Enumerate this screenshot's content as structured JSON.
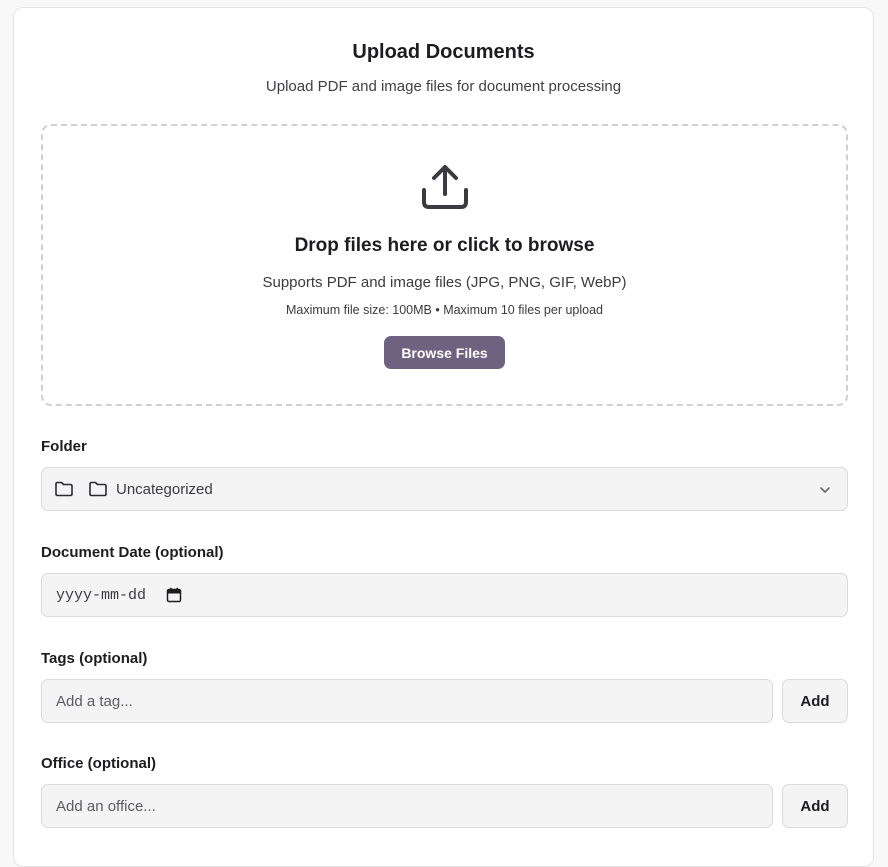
{
  "header": {
    "title": "Upload Documents",
    "subtitle": "Upload PDF and image files for document processing"
  },
  "dropzone": {
    "icon": "upload-icon",
    "title": "Drop files here or click to browse",
    "support_text": "Supports PDF and image files (JPG, PNG, GIF, WebP)",
    "limits_text": "Maximum file size: 100MB • Maximum 10 files per upload",
    "browse_label": "Browse Files"
  },
  "folder": {
    "label": "Folder",
    "selected": "Uncategorized",
    "icon": "folder-icon"
  },
  "document_date": {
    "label": "Document Date (optional)",
    "placeholder": "yyyy-mm-dd"
  },
  "tags": {
    "label": "Tags (optional)",
    "placeholder": "Add a tag...",
    "add_label": "Add"
  },
  "office": {
    "label": "Office (optional)",
    "placeholder": "Add an office...",
    "add_label": "Add"
  },
  "colors": {
    "accent": "#6f6281",
    "field_bg": "#f4f4f5",
    "border": "#d9d9de"
  }
}
